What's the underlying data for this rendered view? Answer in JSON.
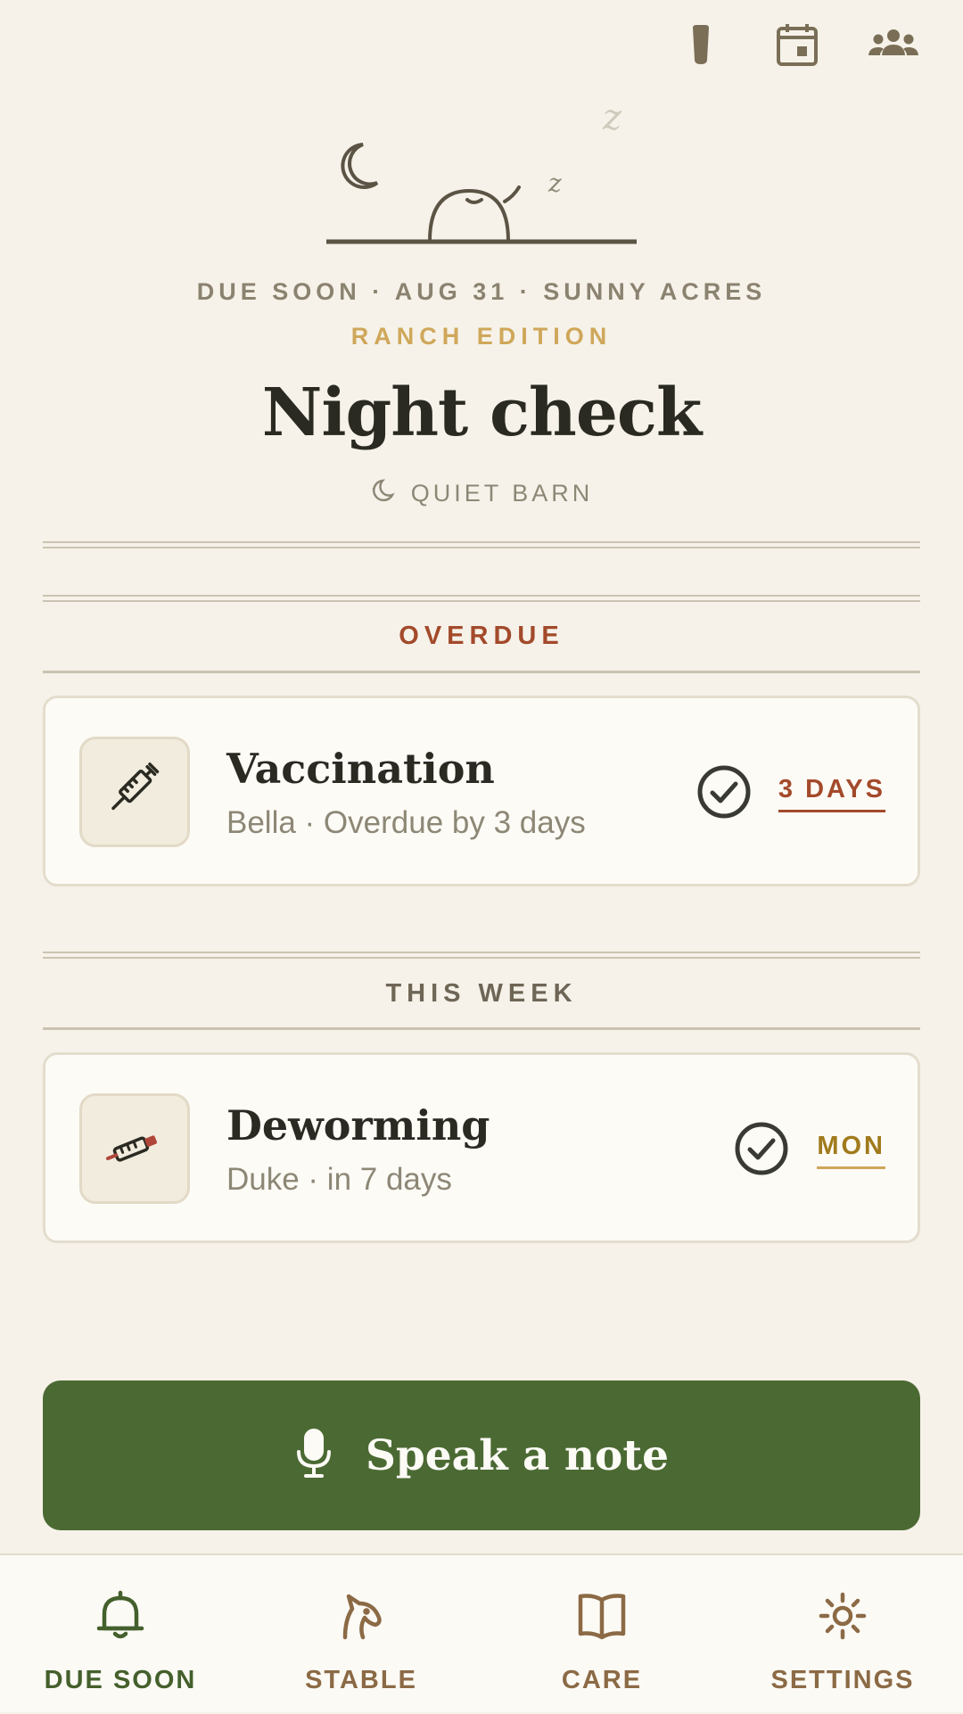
{
  "header": {
    "icons": [
      "flashlight-icon",
      "calendar-icon",
      "people-icon"
    ]
  },
  "hero": {
    "meta_line": "DUE SOON · AUG 31 · SUNNY ACRES",
    "edition": "RANCH EDITION",
    "title": "Night check",
    "mood_label": "QUIET BARN",
    "mood_icon": "moon-icon"
  },
  "sections": [
    {
      "label": "OVERDUE",
      "color": "#a34a2b",
      "items": [
        {
          "title": "Vaccination",
          "subtitle": "Bella · Overdue by 3 days",
          "due": "3 DAYS",
          "due_color": "#a34a2b",
          "icon": "syringe-icon"
        }
      ]
    },
    {
      "label": "THIS WEEK",
      "color": "#6f6656",
      "items": [
        {
          "title": "Deworming",
          "subtitle": "Duke · in 7 days",
          "due": "MON",
          "due_color": "#a07a1c",
          "icon": "dewormer-icon"
        }
      ]
    }
  ],
  "fab": {
    "label": "Speak a note",
    "icon": "microphone-icon",
    "color": "#4b6a33"
  },
  "nav": [
    {
      "label": "DUE SOON",
      "icon": "bell-icon",
      "active": true
    },
    {
      "label": "STABLE",
      "icon": "horse-head-icon",
      "active": false
    },
    {
      "label": "CARE",
      "icon": "book-icon",
      "active": false
    },
    {
      "label": "SETTINGS",
      "icon": "gear-icon",
      "active": false
    }
  ]
}
